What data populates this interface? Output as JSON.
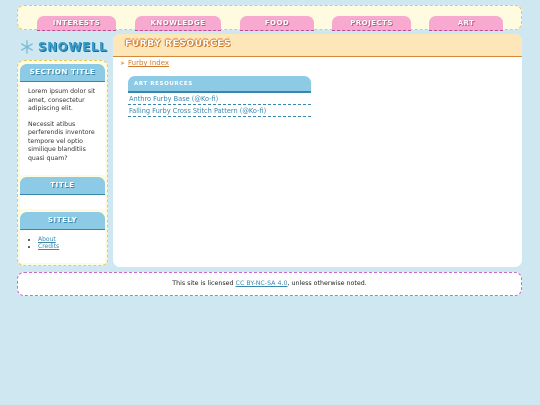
{
  "nav": {
    "tabs": [
      {
        "label": "INTERESTS"
      },
      {
        "label": "KNOWLEDGE"
      },
      {
        "label": "FOOD"
      },
      {
        "label": "PROJECTS"
      },
      {
        "label": "ART"
      }
    ]
  },
  "logo": {
    "text": "SNOWELL",
    "icon": "snowflake-icon"
  },
  "sidebar": {
    "section1": {
      "title": "SECTION TITLE",
      "text1": "Lorem ipsum dolor sit amet, consectetur adipiscing elit.",
      "text2": "Necessit atibus perferendis inventore tempore vel optio similique blanditiis quasi quam?"
    },
    "section2": {
      "title": "TITLE"
    },
    "section3": {
      "title": "SITELY",
      "links": [
        {
          "label": "About"
        },
        {
          "label": "Credits"
        }
      ]
    }
  },
  "main": {
    "title": "FURBY RESOURCES",
    "breadcrumb": {
      "arrow": "➤",
      "link": "Furby Index"
    },
    "resources": {
      "title": "ART RESOURCES",
      "items": [
        {
          "label": "Anthro Furby Base (@Ko-fi)"
        },
        {
          "label": "Falling Furby Cross Stitch Pattern (@Ko-fi)"
        }
      ]
    }
  },
  "footer": {
    "prefix": "This site is licensed ",
    "license": "CC BY-NC-SA 4.0",
    "suffix": ", unless otherwise noted."
  },
  "colors": {
    "background": "#cfe7f1",
    "nav_tab": "#f7a9cf",
    "accent_blue": "#8ccae5",
    "header_peach": "#fde7b8",
    "link_orange": "#d07a2a",
    "link_blue": "#3a87ad"
  }
}
